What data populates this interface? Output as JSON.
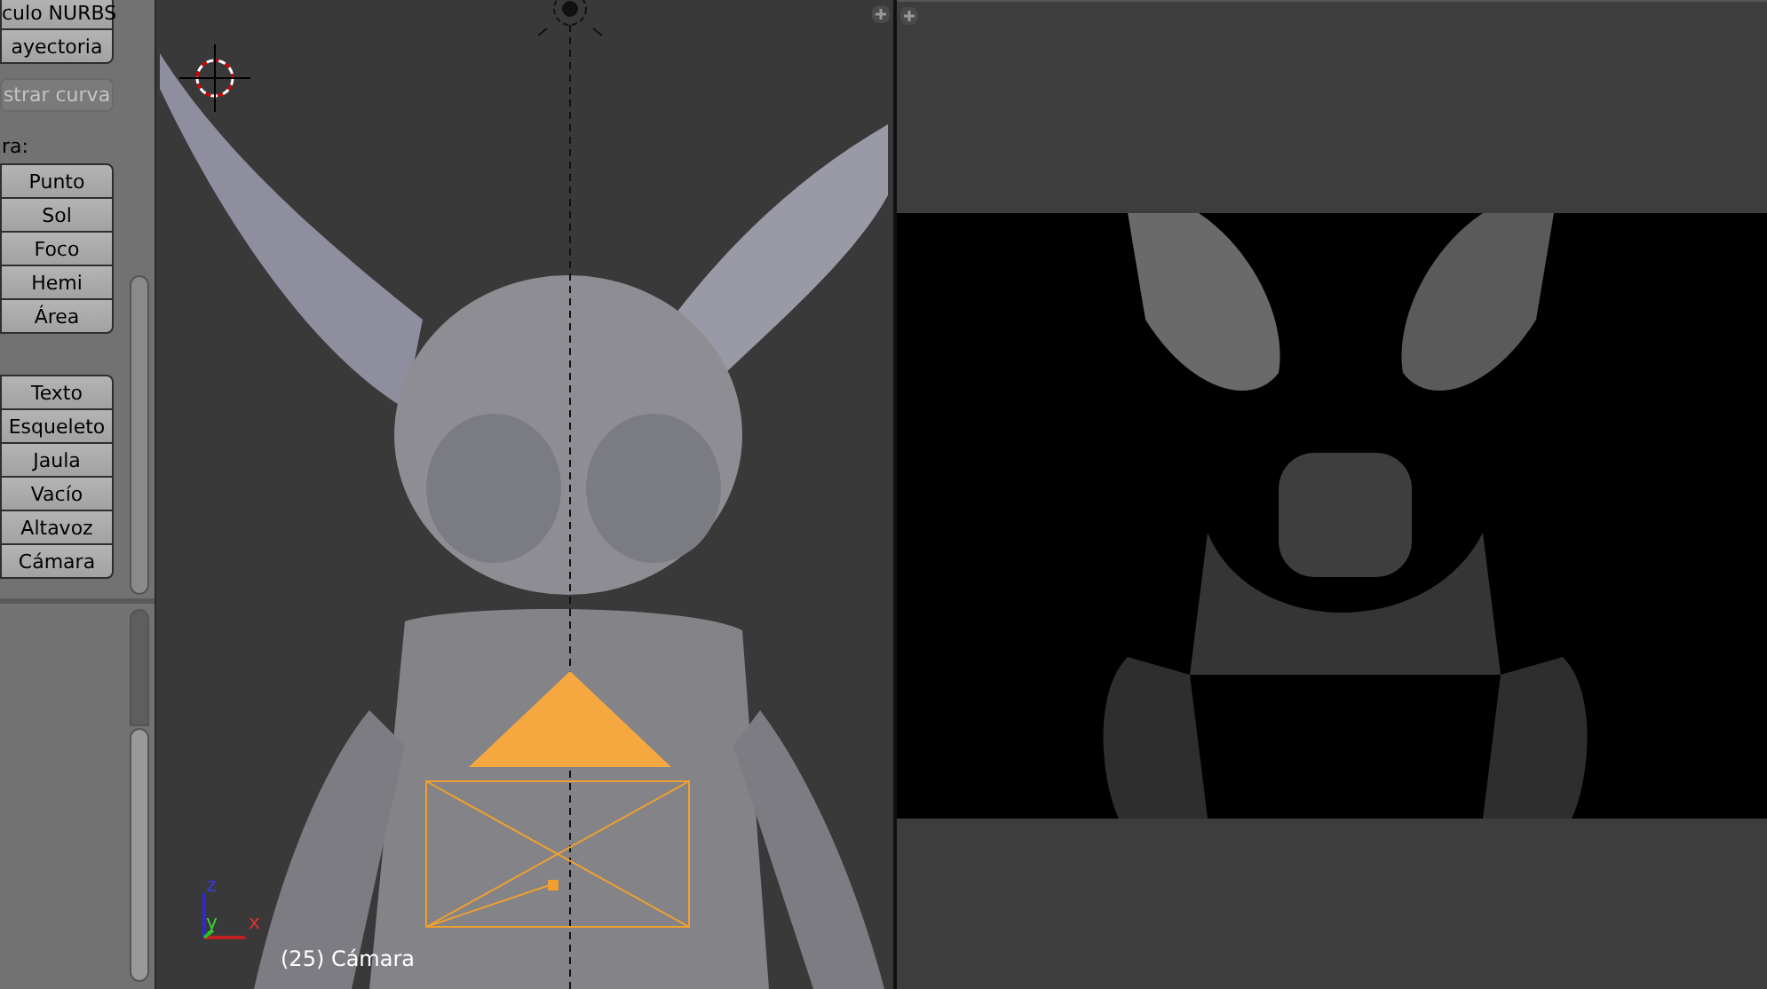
{
  "toolshelf": {
    "sections": [
      {
        "buttons": [
          {
            "label": "culo NURBS",
            "disabled": false
          },
          {
            "label": "ayectoria",
            "disabled": false
          }
        ]
      },
      {
        "buttons": [
          {
            "label": "strar curva",
            "disabled": true
          }
        ]
      },
      {
        "heading": "ra:",
        "buttons": [
          {
            "label": "Punto",
            "disabled": false
          },
          {
            "label": "Sol",
            "disabled": false
          },
          {
            "label": "Foco",
            "disabled": false
          },
          {
            "label": "Hemi",
            "disabled": false
          },
          {
            "label": "Área",
            "disabled": false
          }
        ]
      },
      {
        "buttons": [
          {
            "label": "Texto",
            "disabled": false
          },
          {
            "label": "Esqueleto",
            "disabled": false
          },
          {
            "label": "Jaula",
            "disabled": false
          },
          {
            "label": "Vacío",
            "disabled": false
          },
          {
            "label": "Altavoz",
            "disabled": false
          },
          {
            "label": "Cámara",
            "disabled": false
          }
        ]
      }
    ]
  },
  "viewport": {
    "axes": [
      "z",
      "y",
      "x"
    ],
    "object_label": "(25) Cámara"
  }
}
